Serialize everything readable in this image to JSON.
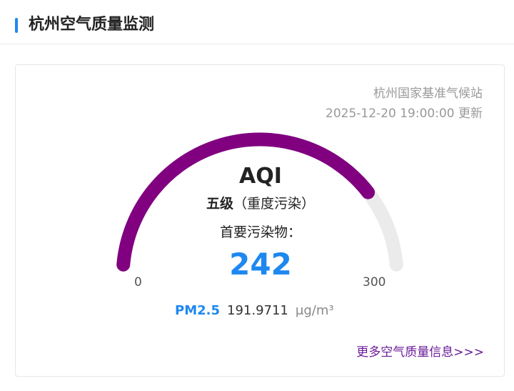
{
  "header": {
    "title": "杭州空气质量监测"
  },
  "station": {
    "name": "杭州国家基准气候站",
    "updated": "2025-12-20 19:00:00 更新"
  },
  "gauge": {
    "min": 0,
    "max": 300,
    "value": 242,
    "min_label": "0",
    "max_label": "300",
    "fill_color": "#800080",
    "track_color": "#ebebeb"
  },
  "aqi": {
    "label": "AQI",
    "level_grade": "五级",
    "level_desc": "（重度污染）",
    "primary_label": "首要污染物：",
    "value": "242",
    "value_color": "#1e88f0"
  },
  "pollutant": {
    "name": "PM2.5",
    "value": "191.9711",
    "unit": "μg/m³"
  },
  "more_link": "更多空气质量信息>>>"
}
